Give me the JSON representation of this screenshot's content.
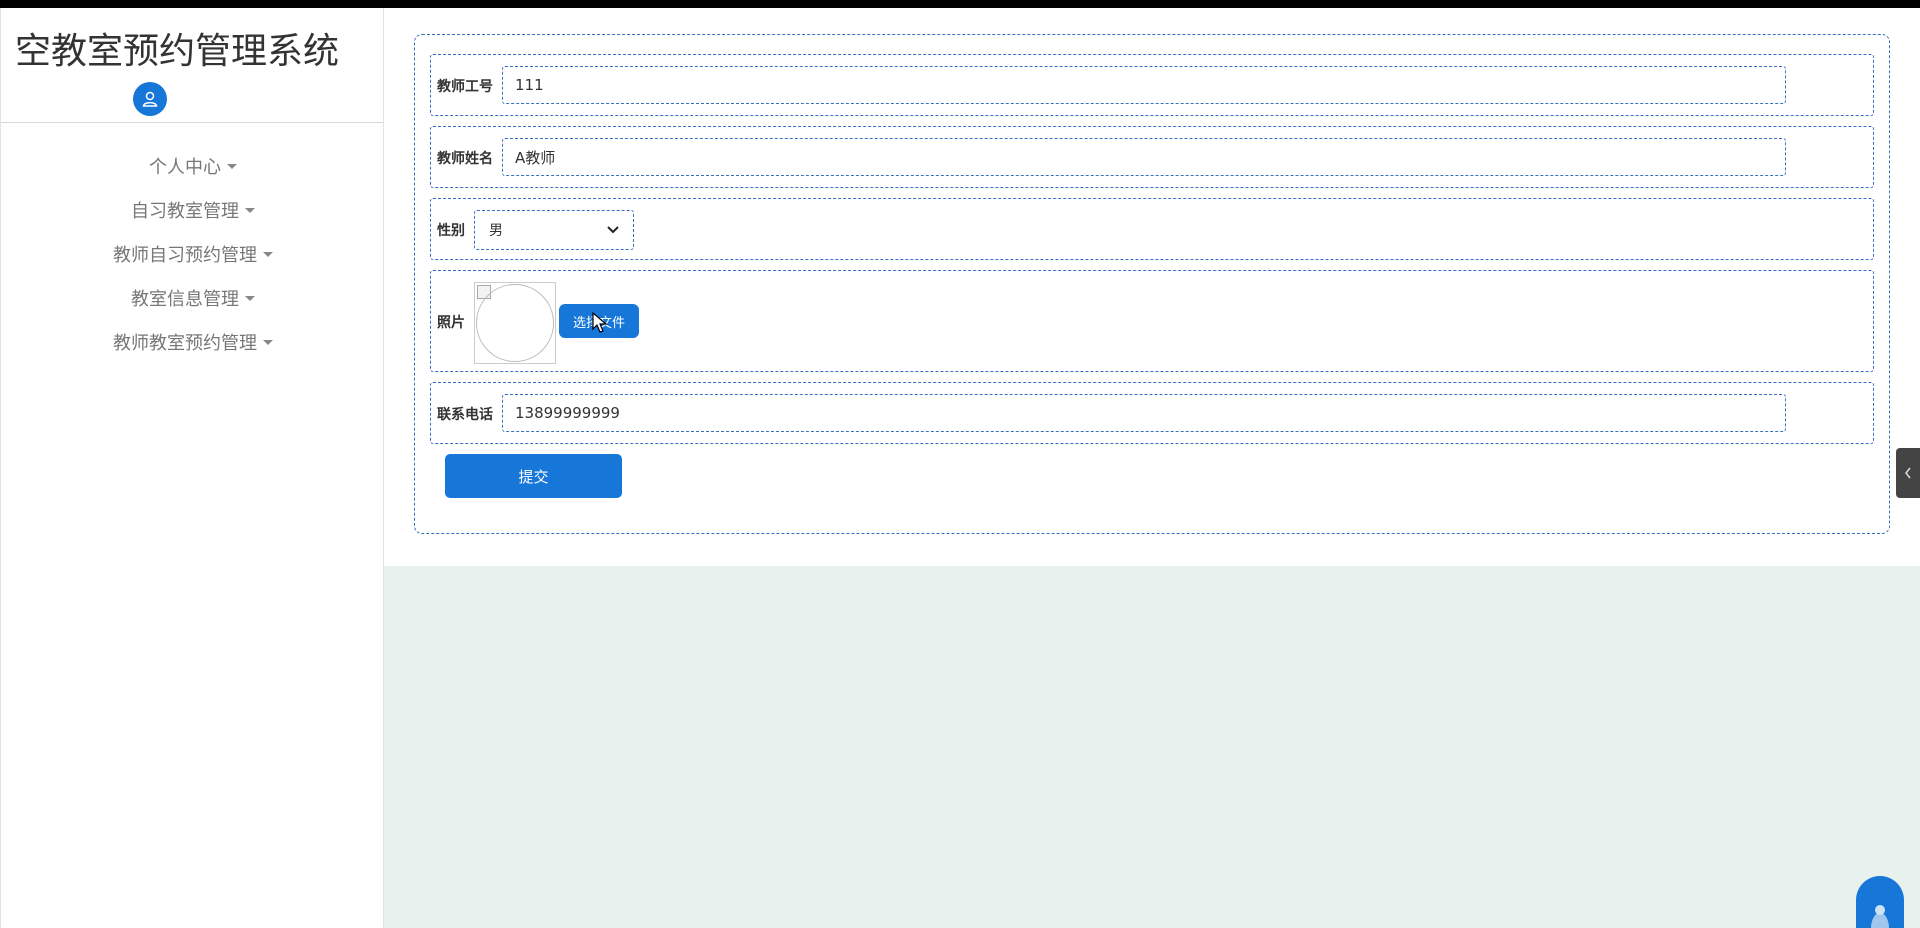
{
  "app": {
    "title": "空教室预约管理系统"
  },
  "sidebar": {
    "items": [
      {
        "label": "个人中心"
      },
      {
        "label": "自习教室管理"
      },
      {
        "label": "教师自习预约管理"
      },
      {
        "label": "教室信息管理"
      },
      {
        "label": "教师教室预约管理"
      }
    ]
  },
  "form": {
    "teacher_id": {
      "label": "教师工号",
      "value": "111"
    },
    "teacher_name": {
      "label": "教师姓名",
      "value": "A教师"
    },
    "gender": {
      "label": "性别",
      "selected": "男"
    },
    "photo": {
      "label": "照片",
      "button_label": "选择文件"
    },
    "phone": {
      "label": "联系电话",
      "value": "13899999999"
    },
    "submit_label": "提交"
  },
  "colors": {
    "primary": "#1677d9",
    "border": "#3b6fbf",
    "content_bg": "#e8f1ee"
  },
  "icons": {
    "avatar": "user-icon",
    "caret": "caret-down-icon",
    "toggle": "chevron-left-icon"
  }
}
